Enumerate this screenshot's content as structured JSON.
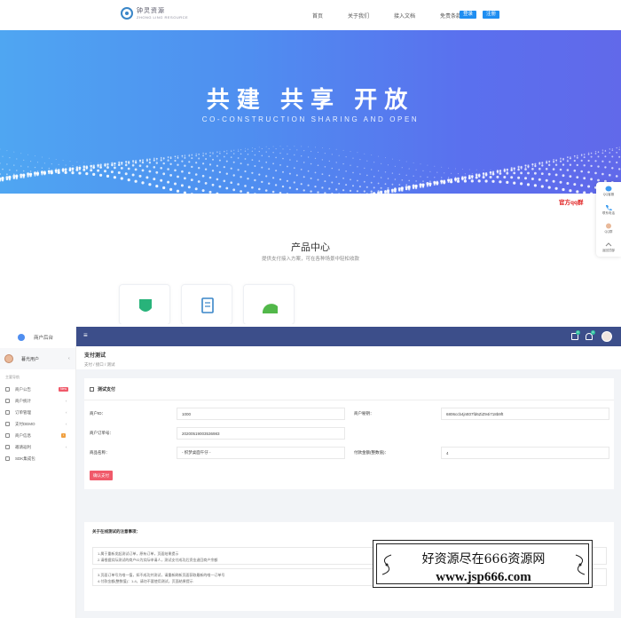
{
  "landing": {
    "logo": {
      "cn": "钟灵资源",
      "en": "ZHONG LING RESOURCE"
    },
    "nav": [
      "首页",
      "关于我们",
      "接入文档",
      "免责条款"
    ],
    "login_label": "登录",
    "register_label": "注册",
    "hero_title": "共建  共享  开放",
    "hero_subtitle": "CO-CONSTRUCTION SHARING AND OPEN",
    "section_title": "产品中心",
    "section_subtitle": "提供支付接入方案，可在各种场景中轻松收款",
    "float_items": [
      "QQ客服",
      "联系电话",
      "QQ群",
      "返回顶部"
    ],
    "qq_banner": "官方qq群",
    "colors": {
      "hero_start": "#4fa6f2",
      "hero_end": "#6169ea",
      "brand_blue": "#1f8ef1"
    }
  },
  "admin": {
    "brand": "商户后台",
    "user": "暮光用户",
    "section_label": "主要导航",
    "menu": [
      {
        "label": "商户公告",
        "badge": "New",
        "arrow": ""
      },
      {
        "label": "商户统计",
        "badge": "",
        "arrow": "‹"
      },
      {
        "label": "订单管理",
        "badge": "",
        "arrow": "‹"
      },
      {
        "label": "支付DEMO",
        "badge": "",
        "arrow": "‹"
      },
      {
        "label": "商户信息",
        "badge": "•",
        "arrow": ""
      },
      {
        "label": "邀请返利",
        "badge": "",
        "arrow": "‹"
      },
      {
        "label": "SDK集成包",
        "badge": "",
        "arrow": ""
      }
    ],
    "topbar": {
      "msg_count": "0",
      "notify_count": "0"
    },
    "page_title": "支付测试",
    "breadcrumb": "支付 / 接口 / 测试",
    "form": {
      "title": "测试支付",
      "merchant_id_label": "商户ID：",
      "merchant_id_value": "1000",
      "merchant_key_label": "商户秘钥：",
      "merchant_key_value": "6806ccb4jntt07fd6ZiZ94i718b9ft",
      "order_no_label": "商户订单号：",
      "order_no_value": "20200519003536983",
      "product_label": "商品名称：",
      "product_value": "- 织梦桌面午仔 -",
      "amount_label": "付款金额(整数值)：",
      "amount_value": "4",
      "submit_label": "确认支付"
    },
    "notes": {
      "title": "关于在线测试的注意事项：",
      "lines_a": [
        "1.属于重新发起测试订单，原有订单，页面结果提示",
        "2.请根据实际测试的商户ID为实际申请人，测试支付成功后资金退回商户余额"
      ],
      "lines_b": [
        "3.页面订单号为唯一值，如不成功并测试，请重新刷新页面获取最新的唯一订单号",
        "4.付款金额(整数值)：1-4，请勿不要使用测试，页面结果提示"
      ]
    }
  },
  "watermark": {
    "line1": "好资源尽在666资源网",
    "line2": "www.jsp666.com"
  }
}
